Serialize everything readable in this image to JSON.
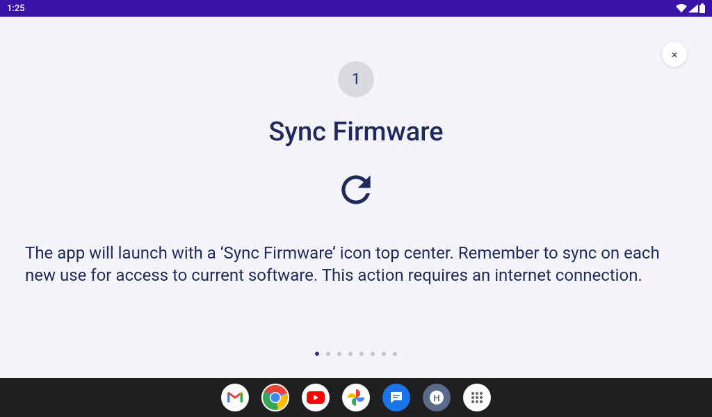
{
  "status_bar": {
    "time": "1:25"
  },
  "close_label": "×",
  "step": {
    "number": "1",
    "title": "Sync Firmware",
    "description": "The app will launch with a ‘Sync Firmware’ icon top center. Remember to sync on each new use for access to current software. This action requires an internet connection."
  },
  "pagination": {
    "total": 8,
    "current": 1
  },
  "nav": {
    "apps": [
      "gmail",
      "chrome",
      "youtube",
      "photos",
      "messages",
      "h-app",
      "app-drawer"
    ]
  }
}
